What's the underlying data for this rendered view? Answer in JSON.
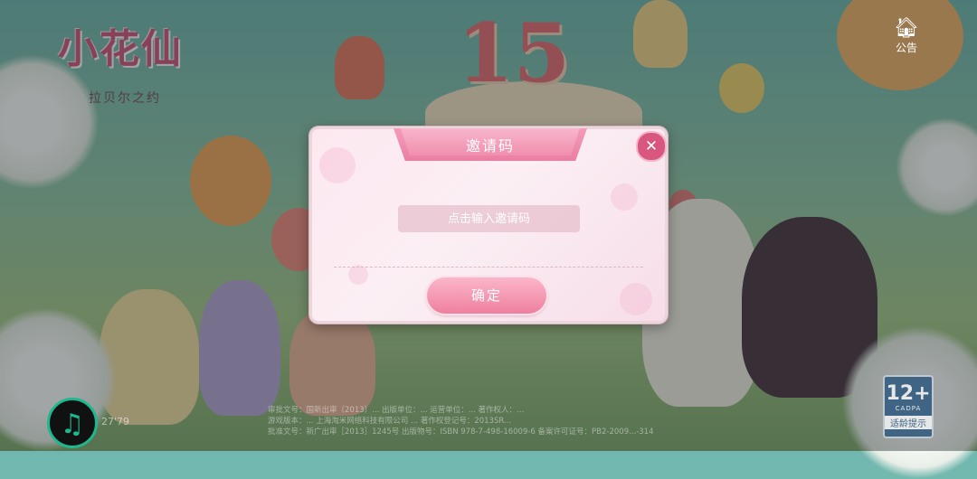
{
  "game": {
    "logo_title": "小花仙",
    "logo_subtitle": "拉贝尔之约",
    "anniversary_number": "15"
  },
  "notice": {
    "icon": "notice-bell-icon",
    "label": "公告"
  },
  "invite_modal": {
    "title": "邀请码",
    "input_placeholder": "点击输入邀请码",
    "input_value": "",
    "confirm_label": "确定",
    "close_icon": "close-icon",
    "accent_color": "#ea7fa3"
  },
  "age_rating": {
    "number": "12+",
    "org": "CADPA",
    "tip": "适龄提示"
  },
  "music": {
    "icon": "music-note-icon",
    "time": "27'79"
  },
  "legal_text": [
    "审批文号：国新出审〔2013〕... 出版单位：... 运营单位：... 著作权人：...",
    "游戏版本：... 上海淘米网络科技有限公司 ... 著作权登记号：2013SR...",
    "批准文号：新广出审［2013］1245号   出版物号：ISBN 978-7-498-16009-6   备案许可证号：PB2-2009...-314"
  ]
}
